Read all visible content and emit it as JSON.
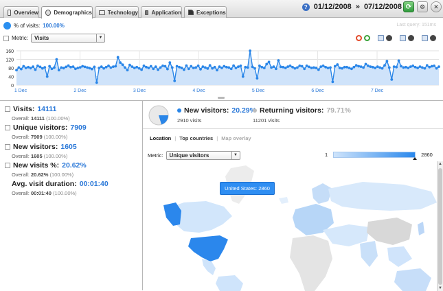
{
  "tabs": [
    {
      "label": "Overview",
      "icon": "document-icon",
      "active": false
    },
    {
      "label": "Demographics",
      "icon": "globe-icon",
      "active": true
    },
    {
      "label": "Technology",
      "icon": "monitor-icon",
      "active": false
    },
    {
      "label": "Application",
      "icon": "folder-icon",
      "active": false
    },
    {
      "label": "Exceptions",
      "icon": "flag-icon",
      "active": false
    }
  ],
  "header": {
    "help": "?",
    "date_from": "01/12/2008",
    "date_sep": "»",
    "date_to": "07/12/2008"
  },
  "summary": {
    "pct_label": "% of visits:",
    "pct_value": "100.00%",
    "last_query": "Last query: 151ms",
    "metric_label": "Metric:",
    "metric_value": "Visits"
  },
  "chart_data": {
    "type": "line",
    "title": "",
    "xlabel": "",
    "ylabel": "",
    "ylim": [
      0,
      160
    ],
    "yticks": [
      "0",
      "40",
      "80",
      "120",
      "160"
    ],
    "xticks": [
      "1 Dec",
      "2 Dec",
      "3 Dec",
      "4 Dec",
      "5 Dec",
      "6 Dec",
      "7 Dec"
    ],
    "grid": true,
    "colors": {
      "line": "#2a86e8",
      "fill": "#cfe3fa"
    },
    "series": [
      {
        "values": [
          70,
          82,
          75,
          88,
          80,
          84,
          79,
          86,
          72,
          90,
          85,
          78,
          83,
          40,
          88,
          76,
          82,
          120,
          70,
          82,
          79,
          85,
          91,
          84,
          86,
          76,
          80,
          83,
          88,
          85,
          82,
          79,
          75,
          85,
          12,
          80,
          86,
          78,
          84,
          90,
          82,
          86,
          88,
          130,
          105,
          95,
          82,
          70,
          94,
          86,
          80,
          84,
          78,
          72,
          90,
          84,
          80,
          88,
          76,
          86,
          72,
          82,
          90,
          88,
          75,
          105,
          82,
          20,
          88,
          84,
          80,
          72,
          91,
          76,
          88,
          80,
          82,
          90,
          74,
          86,
          82,
          77,
          92,
          78,
          84,
          70,
          86,
          80,
          88,
          84,
          82,
          76,
          91,
          80,
          86,
          90,
          40,
          84,
          82,
          160,
          85,
          78,
          32,
          90,
          84,
          80,
          98,
          108,
          82,
          86,
          76,
          115,
          85,
          84,
          80,
          86,
          90,
          84,
          78,
          82,
          90,
          88,
          76,
          90,
          85,
          80,
          82,
          80,
          72,
          86,
          90,
          84,
          80,
          82,
          15,
          88,
          96,
          80,
          78,
          84,
          84,
          80,
          76,
          84,
          92,
          88,
          86,
          82,
          98,
          90,
          86,
          84,
          80,
          86,
          82,
          78,
          92,
          112,
          82,
          26,
          86,
          84,
          114,
          88,
          82,
          84,
          80,
          86,
          90,
          84,
          80,
          86,
          82,
          78,
          92,
          84,
          88,
          90,
          78,
          86
        ]
      }
    ]
  },
  "stats": [
    {
      "label": "Visits:",
      "value": "14111",
      "overall_label": "Overall:",
      "overall_value": "14111",
      "overall_pct": "(100.00%)",
      "icon": true
    },
    {
      "label": "Unique visitors:",
      "value": "7909",
      "overall_label": "Overall:",
      "overall_value": "7909",
      "overall_pct": "(100.00%)",
      "icon": true
    },
    {
      "label": "New visitors:",
      "value": "1605",
      "overall_label": "Overall:",
      "overall_value": "1605",
      "overall_pct": "(100.00%)",
      "icon": true
    },
    {
      "label": "New visits %:",
      "value": "20.62%",
      "overall_label": "Overall:",
      "overall_value": "20.62%",
      "overall_pct": "(100.00%)",
      "icon": true
    },
    {
      "label": "Avg. visit duration:",
      "value": "00:01:40",
      "overall_label": "Overall:",
      "overall_value": "00:01:40",
      "overall_pct": "(100.00%)",
      "icon": false
    }
  ],
  "visitors": {
    "new_label": "New visitors:",
    "new_pct": "20.29%",
    "new_visits": "2910 visits",
    "returning_label": "Returning visitors:",
    "returning_pct": "79.71%",
    "returning_visits": "11201 visits",
    "new_fraction": 0.2029,
    "colors": {
      "new": "#2a86e8",
      "returning": "#e9e9e9"
    }
  },
  "map_tabs": [
    {
      "label": "Location",
      "active": true
    },
    {
      "label": "Top countries",
      "active": false
    },
    {
      "label": "Map overlay",
      "active": false,
      "dim": true
    }
  ],
  "map": {
    "metric_label": "Metric:",
    "metric_value": "Unique visitors",
    "legend_min": "1",
    "legend_max": "2860",
    "tooltip": "United States: 2860"
  }
}
